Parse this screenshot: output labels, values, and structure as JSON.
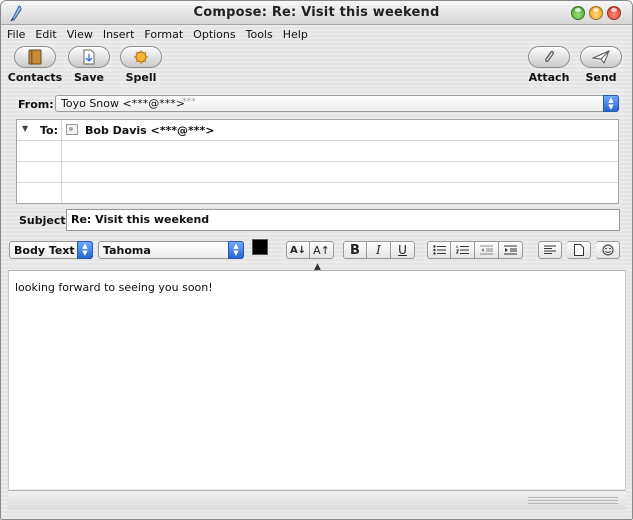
{
  "window": {
    "title": "Compose: Re: Visit this weekend"
  },
  "menu": [
    "File",
    "Edit",
    "View",
    "Insert",
    "Format",
    "Options",
    "Tools",
    "Help"
  ],
  "toolbar": {
    "contacts_label": "Contacts",
    "save_label": "Save",
    "spell_label": "Spell",
    "attach_label": "Attach",
    "send_label": "Send"
  },
  "from": {
    "label": "From:",
    "value": "Toyo Snow <***@***>",
    "extra": "- ***"
  },
  "recipients": {
    "to_label": "To:",
    "to_value": "Bob Davis <***@***>"
  },
  "subject": {
    "label": "Subject:",
    "value": "Re: Visit this weekend"
  },
  "format": {
    "paragraph_style": "Body Text",
    "font_family": "Tahoma",
    "text_color": "#000000",
    "smaller_label": "A↓",
    "larger_label": "A↑",
    "bold_label": "B",
    "italic_label": "I",
    "underline_label": "U"
  },
  "body": {
    "text": "looking forward to seeing you soon!"
  },
  "colors": {
    "accent_blue": "#2f6fe0",
    "close": "#d32d1f",
    "minimize": "#e1930b",
    "zoom": "#3a9a22"
  }
}
